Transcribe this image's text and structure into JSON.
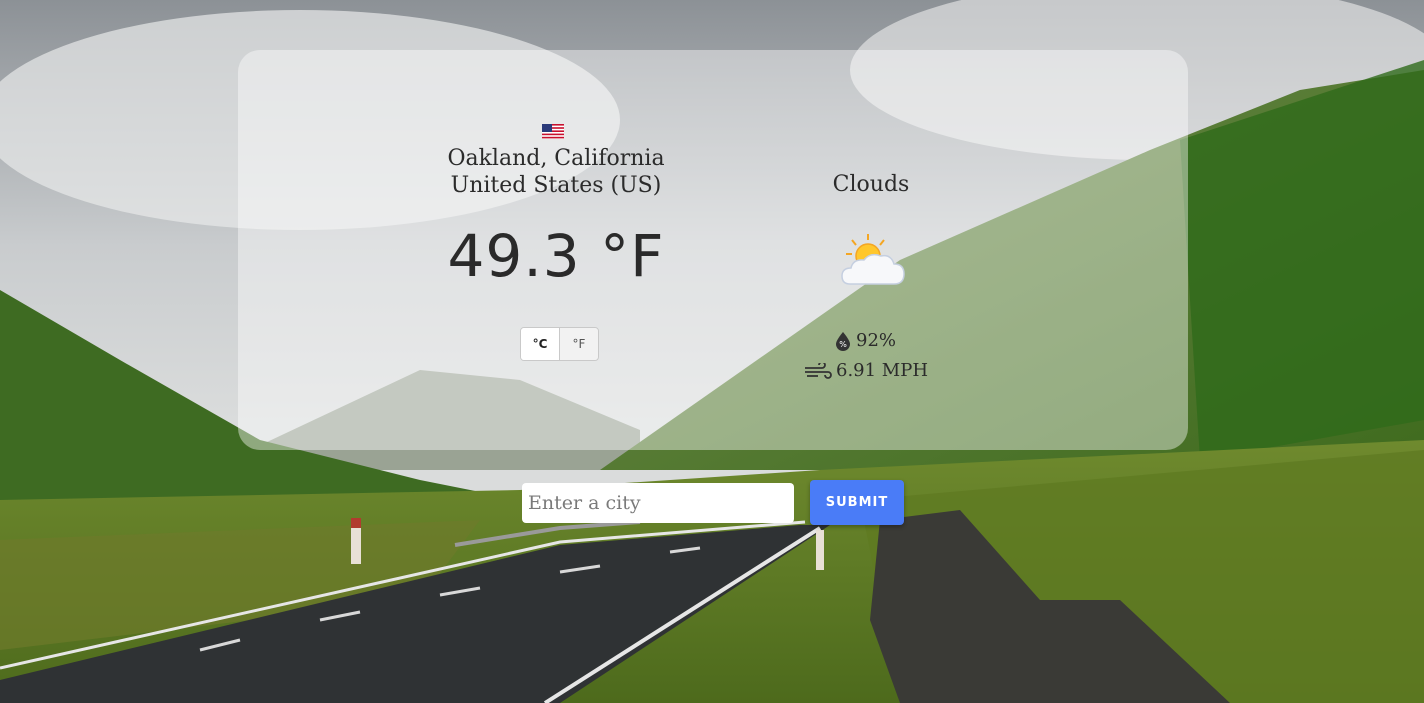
{
  "location": {
    "city_line": "Oakland, California",
    "country_line": "United States (US)",
    "flag_icon": "us-flag-icon"
  },
  "weather": {
    "temperature": "49.3 °F",
    "condition": "Clouds",
    "condition_icon": "sun-behind-cloud-icon",
    "humidity": "92%",
    "wind": "6.91 MPH"
  },
  "units": {
    "celsius_label": "°C",
    "fahrenheit_label": "°F"
  },
  "search": {
    "placeholder": "Enter a city",
    "value": "",
    "submit_label": "SUBMIT"
  },
  "colors": {
    "submit_button": "#4a7cf7",
    "card_background": "rgba(255,255,255,0.42)"
  }
}
